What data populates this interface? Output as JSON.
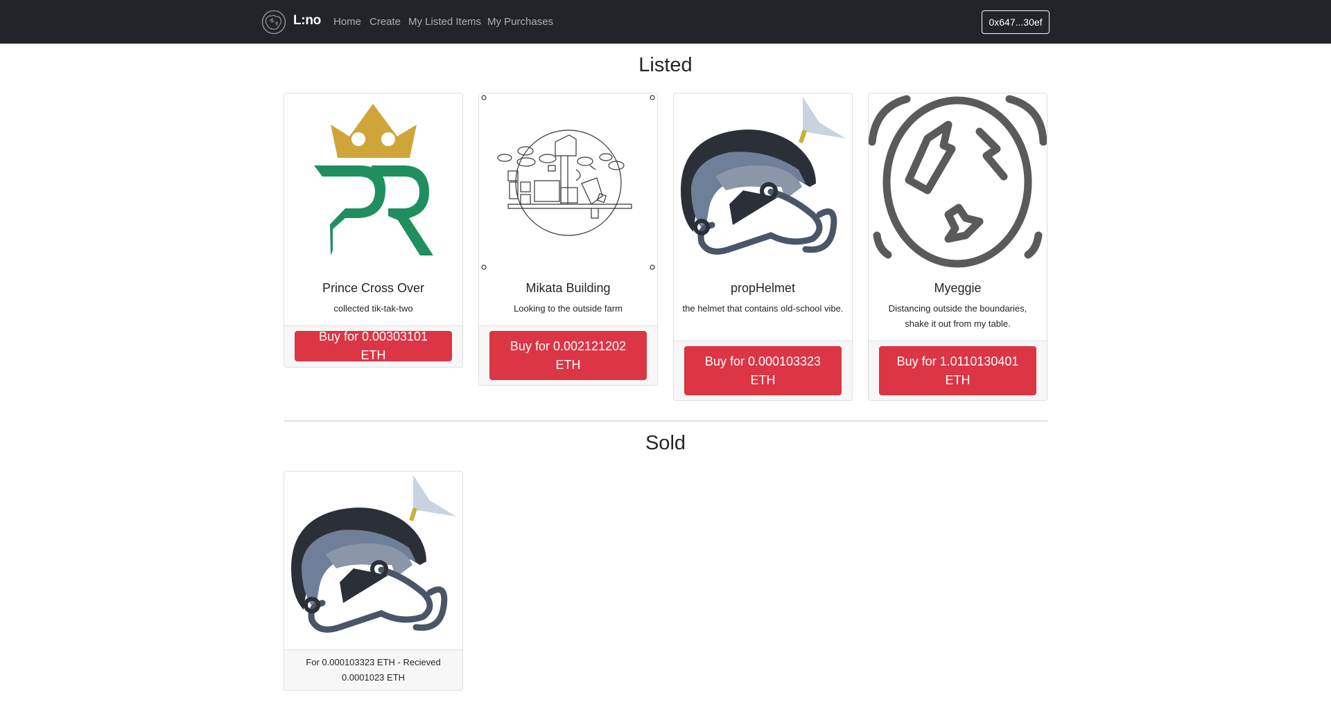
{
  "app": {
    "name": "L:no"
  },
  "nav": {
    "links": [
      "Home",
      "Create",
      "My Listed Items",
      "My Purchases"
    ],
    "wallet": "0x647...30ef"
  },
  "listed": {
    "heading": "Listed",
    "items": [
      {
        "title": "Prince Cross Over",
        "description": "collected tik-tak-two",
        "button": "Buy for 0.00303101 ETH",
        "image": "pr-crown-logo"
      },
      {
        "title": "Mikata Building",
        "description": "Looking to the outside farm",
        "button": "Buy for 0.002121202 ETH",
        "image": "building-sketch"
      },
      {
        "title": "propHelmet",
        "description": "the helmet that contains old-school vibe.",
        "button": "Buy for 0.000103323 ETH",
        "image": "helmet-illustration"
      },
      {
        "title": "Myeggie",
        "description": "Distancing outside the boundaries, shake it out from my table.",
        "button": "Buy for 1.0110130401 ETH",
        "image": "cracked-egg"
      }
    ]
  },
  "sold": {
    "heading": "Sold",
    "items": [
      {
        "text": "For 0.000103323 ETH - Recieved 0.0001023 ETH",
        "image": "helmet-illustration"
      }
    ]
  },
  "colors": {
    "navbar": "#212529",
    "danger": "#dc3545",
    "footer_bg": "#f7f7f7"
  }
}
